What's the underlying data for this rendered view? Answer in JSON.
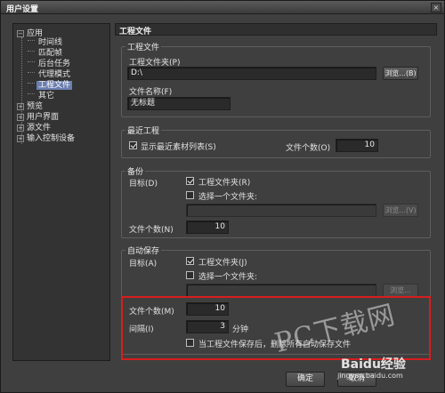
{
  "window": {
    "title": "用户设置",
    "close": "×"
  },
  "tree": {
    "items": [
      {
        "label": "应用",
        "toggle": "−"
      },
      {
        "label": "时间线"
      },
      {
        "label": "匹配帧"
      },
      {
        "label": "后台任务"
      },
      {
        "label": "代理模式"
      },
      {
        "label": "工程文件"
      },
      {
        "label": "其它"
      },
      {
        "label": "预览",
        "toggle": "+"
      },
      {
        "label": "用户界面",
        "toggle": "+"
      },
      {
        "label": "源文件",
        "toggle": "+"
      },
      {
        "label": "输入控制设备",
        "toggle": "+"
      }
    ]
  },
  "panel": {
    "title": "工程文件"
  },
  "project_file": {
    "legend": "工程文件",
    "folder_label": "工程文件夹(P)",
    "folder_value": "D:\\",
    "browse": "浏览...(B)",
    "name_label": "文件名称(F)",
    "name_value": "无标题"
  },
  "recent": {
    "legend": "最近工程",
    "show_recent": "显示最近素材列表(S)",
    "show_recent_checked": true,
    "count_label": "文件个数(O)",
    "count_value": "10"
  },
  "backup": {
    "legend": "备份",
    "target_label": "目标(D)",
    "opt1": "工程文件夹(R)",
    "opt1_checked": true,
    "opt2": "选择一个文件夹:",
    "opt2_checked": false,
    "browse": "浏览...(V)",
    "count_label": "文件个数(N)",
    "count_value": "10"
  },
  "autosave": {
    "legend": "自动保存",
    "target_label": "目标(A)",
    "opt1": "工程文件夹(J)",
    "opt1_checked": true,
    "opt2": "选择一个文件夹:",
    "opt2_checked": false,
    "browse": "浏览...",
    "count_label": "文件个数(M)",
    "count_value": "10",
    "interval_label": "间隔(I)",
    "interval_value": "3",
    "interval_unit": "分钟",
    "delete_label": "当工程文件保存后，删除所有自动保存文件",
    "delete_checked": false
  },
  "footer": {
    "ok": "确定",
    "cancel": "取消"
  },
  "watermark": {
    "big": "PC下载网",
    "logo": "Baidu经验",
    "url": "jingyan.baidu.com"
  },
  "colors": {
    "highlight": "#d81d1d",
    "selection": "#6b7fb0"
  }
}
